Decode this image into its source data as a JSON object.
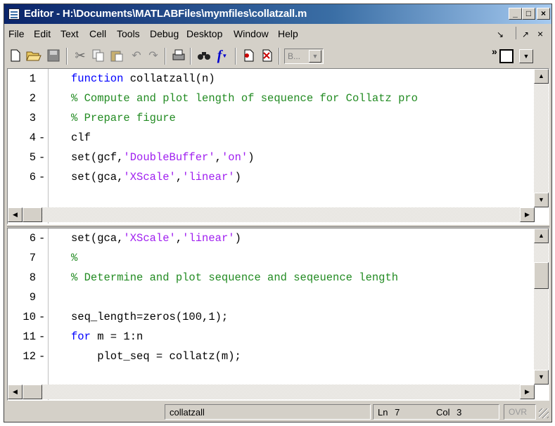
{
  "window": {
    "title": "Editor - H:\\Documents\\MATLABFiles\\mymfiles\\collatzall.m"
  },
  "menu": [
    "File",
    "Edit",
    "Text",
    "Cell",
    "Tools",
    "Debug",
    "Desktop",
    "Window",
    "Help"
  ],
  "toolbar": {
    "buttons": [
      "new-file",
      "open-file",
      "save",
      "cut",
      "copy",
      "paste",
      "undo",
      "redo",
      "print",
      "find",
      "function",
      "insert-breakpoint",
      "clear-breakpoint"
    ],
    "stack_select": "B...",
    "more": "»"
  },
  "colors": {
    "keyword": "#0000ff",
    "comment": "#228b22",
    "string": "#a020f0"
  },
  "pane_top": {
    "lines": [
      {
        "num": "1",
        "dash": "",
        "segs": [
          [
            "kw",
            "function"
          ],
          [
            "pl",
            " collatzall(n)"
          ]
        ]
      },
      {
        "num": "2",
        "dash": "",
        "segs": [
          [
            "cm",
            "% Compute and plot length of sequence for Collatz pro"
          ]
        ]
      },
      {
        "num": "3",
        "dash": "",
        "segs": [
          [
            "cm",
            "% Prepare figure"
          ]
        ]
      },
      {
        "num": "4",
        "dash": "-",
        "segs": [
          [
            "pl",
            "clf"
          ]
        ]
      },
      {
        "num": "5",
        "dash": "-",
        "segs": [
          [
            "pl",
            "set(gcf,"
          ],
          [
            "st",
            "'DoubleBuffer'"
          ],
          [
            "pl",
            ","
          ],
          [
            "st",
            "'on'"
          ],
          [
            "pl",
            ")"
          ]
        ]
      },
      {
        "num": "6",
        "dash": "-",
        "segs": [
          [
            "pl",
            "set(gca,"
          ],
          [
            "st",
            "'XScale'"
          ],
          [
            "pl",
            ","
          ],
          [
            "st",
            "'linear'"
          ],
          [
            "pl",
            ")"
          ]
        ]
      }
    ]
  },
  "pane_bottom": {
    "lines": [
      {
        "num": "6",
        "dash": "-",
        "segs": [
          [
            "pl",
            "set(gca,"
          ],
          [
            "st",
            "'XScale'"
          ],
          [
            "pl",
            ","
          ],
          [
            "st",
            "'linear'"
          ],
          [
            "pl",
            ")"
          ]
        ]
      },
      {
        "num": "7",
        "dash": "",
        "segs": [
          [
            "cm",
            "%"
          ]
        ]
      },
      {
        "num": "8",
        "dash": "",
        "segs": [
          [
            "cm",
            "% Determine and plot sequence and seqeuence length"
          ]
        ]
      },
      {
        "num": "9",
        "dash": "",
        "segs": []
      },
      {
        "num": "10",
        "dash": "-",
        "segs": [
          [
            "pl",
            "seq_length=zeros(100,1);"
          ]
        ]
      },
      {
        "num": "11",
        "dash": "-",
        "segs": [
          [
            "kw",
            "for"
          ],
          [
            "pl",
            " m = 1:n"
          ]
        ]
      },
      {
        "num": "12",
        "dash": "-",
        "segs": [
          [
            "pl",
            "    plot_seq = collatz(m);"
          ]
        ]
      }
    ]
  },
  "status": {
    "function": "collatzall",
    "ln_label": "Ln",
    "ln": "7",
    "col_label": "Col",
    "col": "3",
    "ovr": "OVR"
  }
}
